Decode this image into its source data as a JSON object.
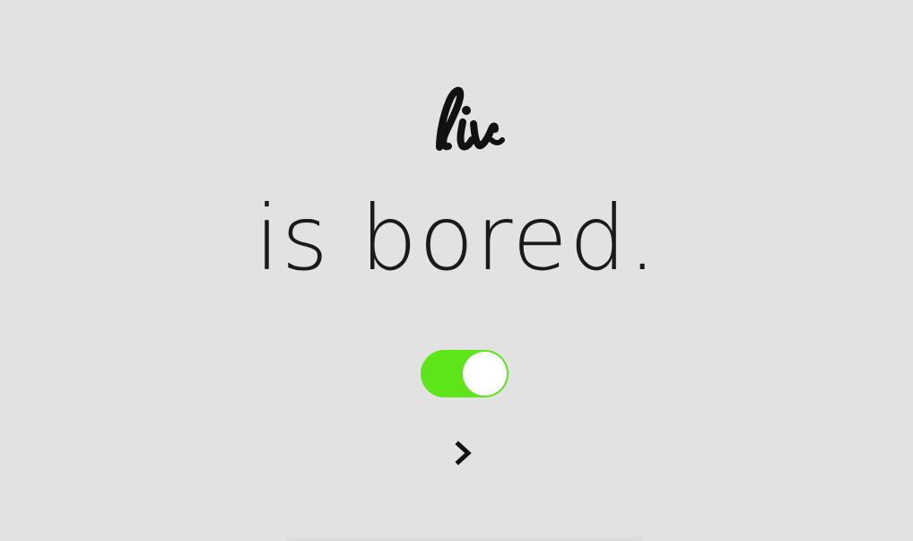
{
  "brand": {
    "logo_text": "liv"
  },
  "status": {
    "text": "is bored."
  },
  "toggle": {
    "state": "on",
    "color_on": "#5ee51a"
  },
  "navigation": {
    "next_icon": "chevron-right-icon"
  },
  "colors": {
    "background": "#e2e2e2",
    "text": "#111111"
  }
}
